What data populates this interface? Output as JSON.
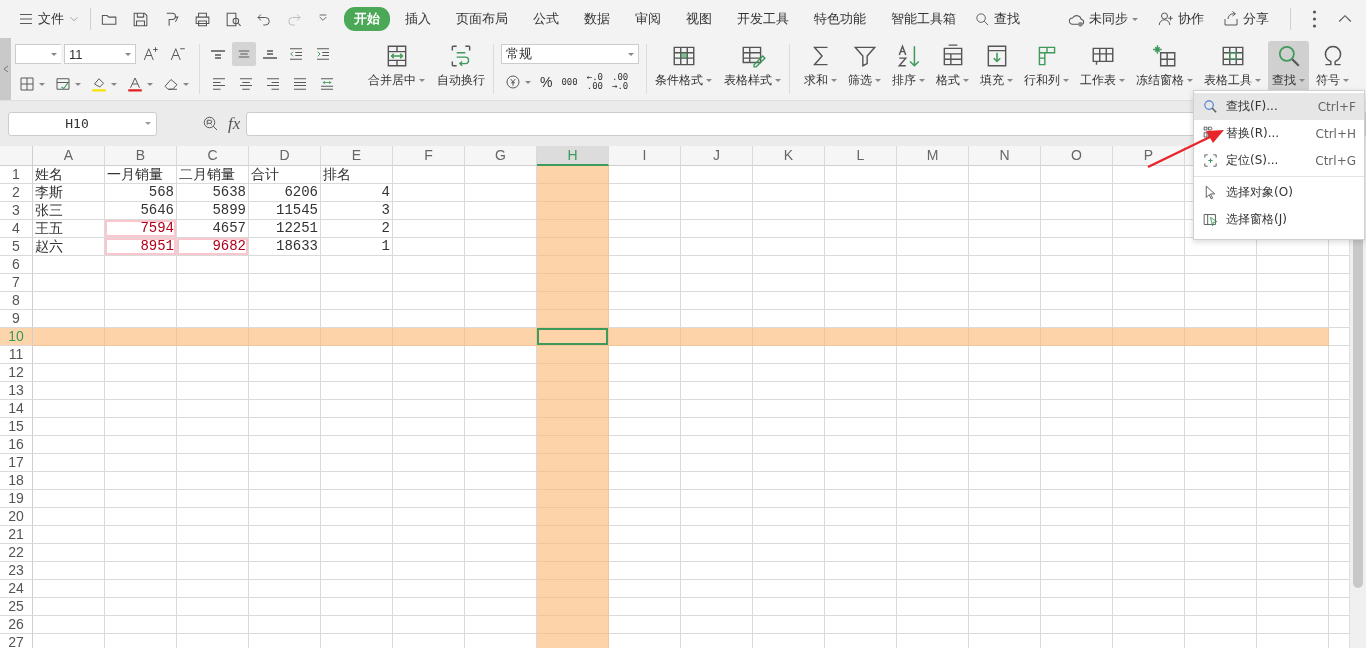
{
  "menu_bar": {
    "file": "文件",
    "tabs": [
      {
        "label": "开始",
        "selected": true
      },
      {
        "label": "插入",
        "selected": false
      },
      {
        "label": "页面布局",
        "selected": false
      },
      {
        "label": "公式",
        "selected": false
      },
      {
        "label": "数据",
        "selected": false
      },
      {
        "label": "审阅",
        "selected": false
      },
      {
        "label": "视图",
        "selected": false
      },
      {
        "label": "开发工具",
        "selected": false
      },
      {
        "label": "特色功能",
        "selected": false
      },
      {
        "label": "智能工具箱",
        "selected": false
      }
    ],
    "search": "查找",
    "sync": "未同步",
    "collaborate": "协作",
    "share": "分享"
  },
  "ribbon": {
    "font_size": "11",
    "number_format": "常规",
    "percent": "%",
    "thousands": "000",
    "decimal_increase": "←.0\n.00",
    "decimal_decrease": ".00\n→.0",
    "buttons": [
      {
        "label": "合并居中",
        "dropdown": true,
        "pressed": false
      },
      {
        "label": "自动换行",
        "dropdown": false,
        "pressed": false
      },
      {
        "label": "条件格式",
        "dropdown": true,
        "pressed": false
      },
      {
        "label": "表格样式",
        "dropdown": true,
        "pressed": false
      },
      {
        "label": "求和",
        "dropdown": true,
        "pressed": false
      },
      {
        "label": "筛选",
        "dropdown": true,
        "pressed": false
      },
      {
        "label": "排序",
        "dropdown": true,
        "pressed": false
      },
      {
        "label": "格式",
        "dropdown": true,
        "pressed": false
      },
      {
        "label": "填充",
        "dropdown": true,
        "pressed": false
      },
      {
        "label": "行和列",
        "dropdown": true,
        "pressed": false
      },
      {
        "label": "工作表",
        "dropdown": true,
        "pressed": false
      },
      {
        "label": "冻结窗格",
        "dropdown": true,
        "pressed": false
      },
      {
        "label": "表格工具",
        "dropdown": true,
        "pressed": false
      },
      {
        "label": "查找",
        "dropdown": true,
        "pressed": true
      },
      {
        "label": "符号",
        "dropdown": true,
        "pressed": false
      }
    ]
  },
  "formula_bar": {
    "name_box": "H10",
    "fx": "fx"
  },
  "sheet": {
    "columns": [
      {
        "label": "A",
        "selected": false
      },
      {
        "label": "B",
        "selected": false
      },
      {
        "label": "C",
        "selected": false
      },
      {
        "label": "D",
        "selected": false
      },
      {
        "label": "E",
        "selected": false
      },
      {
        "label": "F",
        "selected": false
      },
      {
        "label": "G",
        "selected": false
      },
      {
        "label": "H",
        "selected": true
      },
      {
        "label": "I",
        "selected": false
      },
      {
        "label": "J",
        "selected": false
      },
      {
        "label": "K",
        "selected": false
      },
      {
        "label": "L",
        "selected": false
      },
      {
        "label": "M",
        "selected": false
      },
      {
        "label": "N",
        "selected": false
      },
      {
        "label": "O",
        "selected": false
      },
      {
        "label": "P",
        "selected": false
      }
    ],
    "rows": [
      {
        "header": "1",
        "selected": false,
        "cells": [
          {
            "text": "姓名",
            "kind": "text",
            "highlight": false
          },
          {
            "text": "一月销量",
            "kind": "text",
            "highlight": false
          },
          {
            "text": "二月销量",
            "kind": "text",
            "highlight": false
          },
          {
            "text": "合计",
            "kind": "text",
            "highlight": false
          },
          {
            "text": "排名",
            "kind": "text",
            "highlight": false
          }
        ]
      },
      {
        "header": "2",
        "selected": false,
        "cells": [
          {
            "text": "李斯",
            "kind": "text",
            "highlight": false
          },
          {
            "text": "568",
            "kind": "number",
            "highlight": false
          },
          {
            "text": "5638",
            "kind": "number",
            "highlight": false
          },
          {
            "text": "6206",
            "kind": "number",
            "highlight": false
          },
          {
            "text": "4",
            "kind": "number",
            "highlight": false
          }
        ]
      },
      {
        "header": "3",
        "selected": false,
        "cells": [
          {
            "text": "张三",
            "kind": "text",
            "highlight": false
          },
          {
            "text": "5646",
            "kind": "number",
            "highlight": false
          },
          {
            "text": "5899",
            "kind": "number",
            "highlight": false
          },
          {
            "text": "11545",
            "kind": "number",
            "highlight": false
          },
          {
            "text": "3",
            "kind": "number",
            "highlight": false
          }
        ]
      },
      {
        "header": "4",
        "selected": false,
        "cells": [
          {
            "text": "王五",
            "kind": "text",
            "highlight": false
          },
          {
            "text": "7594",
            "kind": "number",
            "highlight": true
          },
          {
            "text": "4657",
            "kind": "number",
            "highlight": false
          },
          {
            "text": "12251",
            "kind": "number",
            "highlight": false
          },
          {
            "text": "2",
            "kind": "number",
            "highlight": false
          }
        ]
      },
      {
        "header": "5",
        "selected": false,
        "cells": [
          {
            "text": "赵六",
            "kind": "text",
            "highlight": false
          },
          {
            "text": "8951",
            "kind": "number",
            "highlight": true
          },
          {
            "text": "9682",
            "kind": "number",
            "highlight": true
          },
          {
            "text": "18633",
            "kind": "number",
            "highlight": false
          },
          {
            "text": "1",
            "kind": "number",
            "highlight": false
          }
        ]
      },
      {
        "header": "6",
        "selected": false
      },
      {
        "header": "7",
        "selected": false
      },
      {
        "header": "8",
        "selected": false
      },
      {
        "header": "9",
        "selected": false
      },
      {
        "header": "10",
        "selected": true
      },
      {
        "header": "11",
        "selected": false
      },
      {
        "header": "12",
        "selected": false
      },
      {
        "header": "13",
        "selected": false
      },
      {
        "header": "14",
        "selected": false
      },
      {
        "header": "15",
        "selected": false
      },
      {
        "header": "16",
        "selected": false
      },
      {
        "header": "17",
        "selected": false
      },
      {
        "header": "18",
        "selected": false
      },
      {
        "header": "19",
        "selected": false
      },
      {
        "header": "20",
        "selected": false
      },
      {
        "header": "21",
        "selected": false
      },
      {
        "header": "22",
        "selected": false
      },
      {
        "header": "23",
        "selected": false
      },
      {
        "header": "24",
        "selected": false
      },
      {
        "header": "25",
        "selected": false
      },
      {
        "header": "26",
        "selected": false
      },
      {
        "header": "27",
        "selected": false
      }
    ]
  },
  "find_menu": {
    "items": [
      {
        "label": "查找(F)...",
        "shortcut": "Ctrl+F",
        "highlighted": true,
        "divider_before": false
      },
      {
        "label": "替换(R)...",
        "shortcut": "Ctrl+H",
        "highlighted": false,
        "divider_before": false
      },
      {
        "label": "定位(S)...",
        "shortcut": "Ctrl+G",
        "highlighted": false,
        "divider_before": false
      },
      {
        "label": "选择对象(O)",
        "highlighted": false,
        "divider_before": true
      },
      {
        "label": "选择窗格(J)",
        "highlighted": false,
        "divider_before": false
      }
    ]
  }
}
